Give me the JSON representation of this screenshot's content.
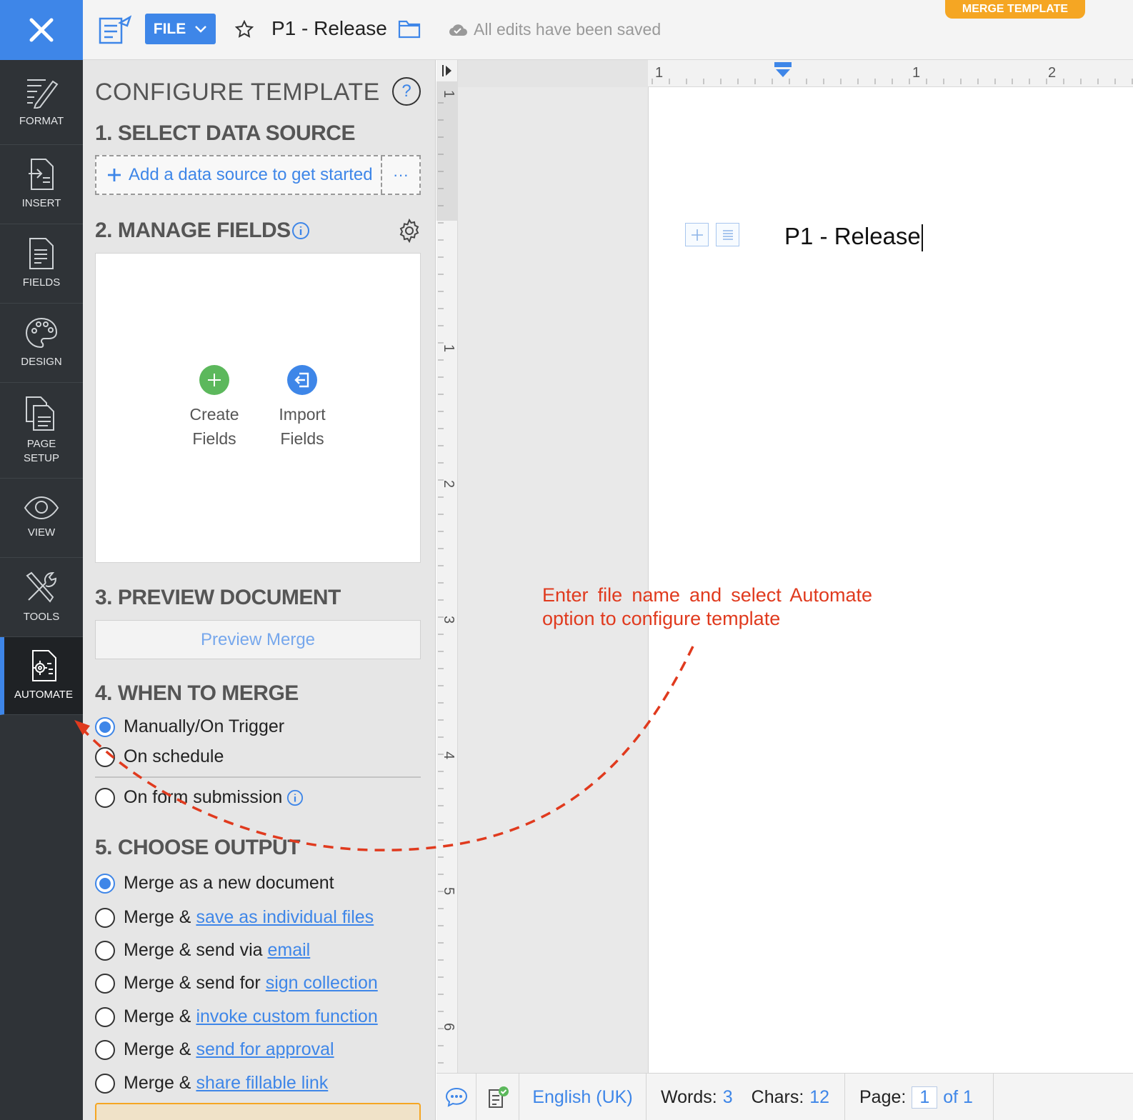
{
  "rail": {
    "items": [
      {
        "label": "FORMAT",
        "icon": "format-pen-icon"
      },
      {
        "label": "INSERT",
        "icon": "insert-doc-icon"
      },
      {
        "label": "FIELDS",
        "icon": "fields-doc-icon"
      },
      {
        "label": "DESIGN",
        "icon": "palette-icon"
      },
      {
        "label": "PAGE\nSETUP",
        "icon": "page-setup-icon"
      },
      {
        "label": "VIEW",
        "icon": "eye-icon"
      },
      {
        "label": "TOOLS",
        "icon": "tools-icon"
      },
      {
        "label": "AUTOMATE",
        "icon": "automate-gear-doc-icon"
      }
    ]
  },
  "topbar": {
    "file_label": "FILE",
    "doc_title": "P1 - Release",
    "save_status": "All edits have been saved",
    "merge_badge": "MERGE TEMPLATE"
  },
  "panel": {
    "title": "CONFIGURE TEMPLATE",
    "help": "?",
    "s1": {
      "heading": "1. SELECT DATA SOURCE",
      "add_label": "Add a data source to get started",
      "more": "···"
    },
    "s2": {
      "heading": "2. MANAGE FIELDS",
      "create": "Create\nFields",
      "import": "Import\nFields"
    },
    "s3": {
      "heading": "3. PREVIEW DOCUMENT",
      "preview_btn": "Preview Merge"
    },
    "s4": {
      "heading": "4. WHEN TO MERGE",
      "opt_manual": "Manually/On Trigger",
      "opt_schedule": "On schedule",
      "opt_form": "On form submission"
    },
    "s5": {
      "heading": "5. CHOOSE OUTPUT",
      "opt_new": "Merge as a new document",
      "merge_and": "Merge & ",
      "send_via": "Merge & send via ",
      "send_for": "Merge & send for ",
      "link_individual": "save as individual files",
      "link_email": "email",
      "link_sign": "sign collection",
      "link_custom": "invoke custom function",
      "link_approval": "send for approval",
      "link_fillable": "share fillable link"
    }
  },
  "editor": {
    "page_heading": "P1 - Release",
    "hruler_labels": [
      "1",
      "1",
      "2"
    ],
    "vruler_labels": [
      "1",
      "1",
      "2",
      "3",
      "4",
      "5",
      "6"
    ],
    "annotation": "Enter file name and select Automate option to configure template"
  },
  "status": {
    "language": "English (UK)",
    "words_label": "Words:",
    "words": "3",
    "chars_label": "Chars:",
    "chars": "12",
    "page_label": "Page:",
    "page_current": "1",
    "page_of": "of 1"
  },
  "colors": {
    "accent": "#3e86e8",
    "rail": "#2f3337",
    "badge": "#f5a623",
    "annotation": "#e03a1e",
    "create": "#5cb85c"
  }
}
